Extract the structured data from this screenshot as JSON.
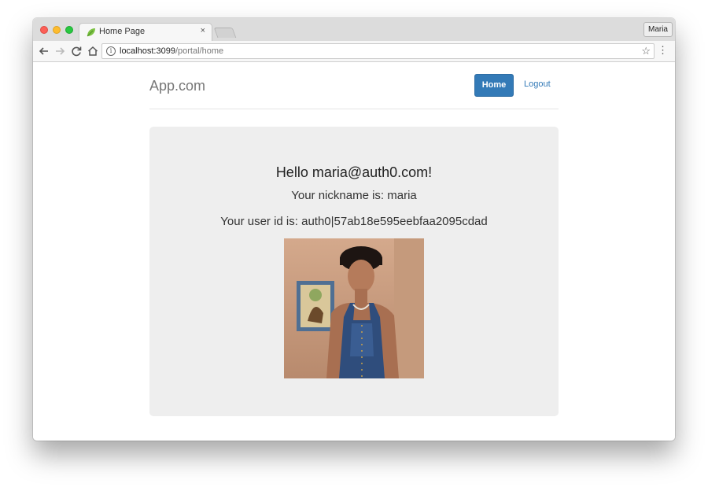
{
  "browser": {
    "tab_title": "Home Page",
    "tab_close": "×",
    "profile_name": "Maria",
    "url_host": "localhost:3099",
    "url_path": "/portal/home",
    "icons": {
      "back": "arrow-left-icon",
      "forward": "arrow-right-icon",
      "reload": "reload-icon",
      "home": "home-icon",
      "info": "info-icon",
      "star": "star-icon",
      "menu": "more-vert-icon"
    }
  },
  "nav": {
    "brand": "App.com",
    "home_label": "Home",
    "logout_label": "Logout"
  },
  "profile": {
    "greeting": "Hello maria@auth0.com!",
    "nickname_line": "Your nickname is: maria",
    "userid_line": "Your user id is: auth0|57ab18e595eebfaa2095cdad"
  },
  "colors": {
    "primary": "#337ab7",
    "jumbotron": "#eeeeee",
    "brand_text": "#777777"
  }
}
